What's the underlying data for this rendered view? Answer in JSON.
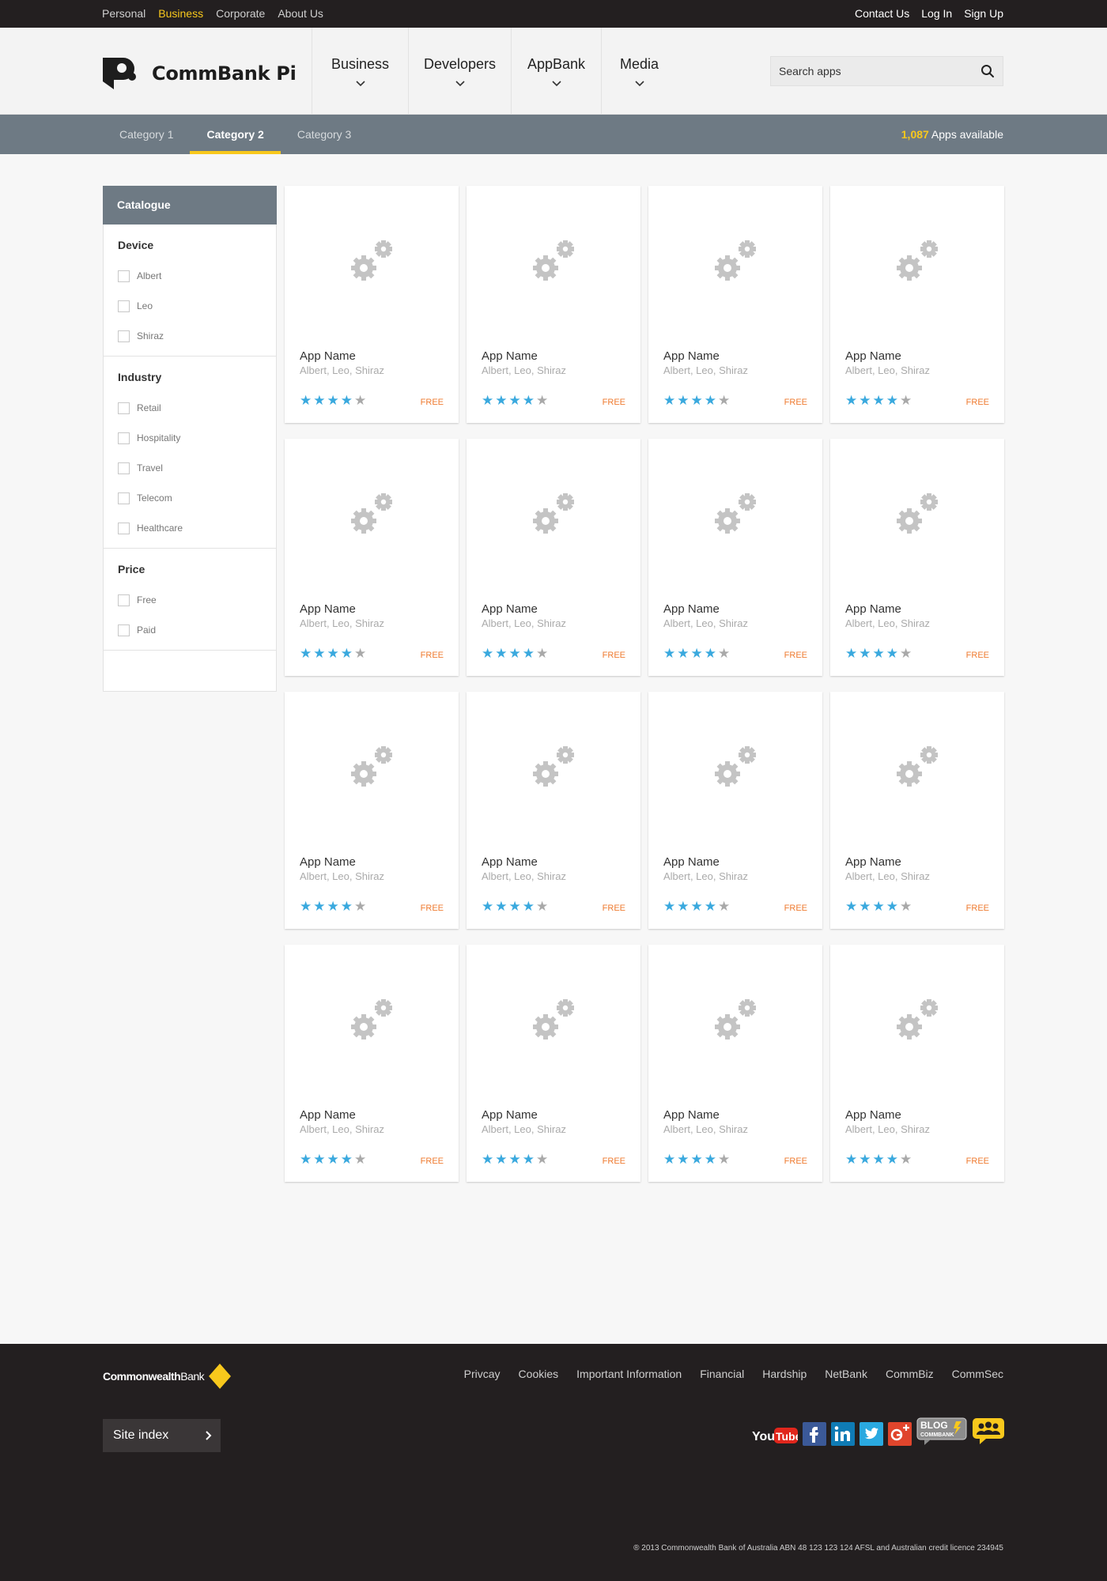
{
  "topbar": {
    "left_links": [
      "Personal",
      "Business",
      "Corporate",
      "About Us"
    ],
    "active_link": "Business",
    "right_links": [
      "Contact Us",
      "Log In",
      "Sign Up"
    ]
  },
  "header": {
    "brand": "CommBank Pi",
    "nav": [
      "Business",
      "Developers",
      "AppBank",
      "Media"
    ],
    "search_placeholder": "Search apps"
  },
  "category_bar": {
    "tabs": [
      "Category 1",
      "Category 2",
      "Category 3"
    ],
    "active_tab": "Category 2",
    "apps_count": "1,087",
    "apps_label": " Apps available"
  },
  "sidebar": {
    "title": "Catalogue",
    "groups": [
      {
        "title": "Device",
        "options": [
          "Albert",
          "Leo",
          "Shiraz"
        ]
      },
      {
        "title": "Industry",
        "options": [
          "Retail",
          "Hospitality",
          "Travel",
          "Telecom",
          "Healthcare"
        ]
      },
      {
        "title": "Price",
        "options": [
          "Free",
          "Paid"
        ]
      }
    ]
  },
  "apps": [
    {
      "name": "App Name",
      "devices": "Albert, Leo, Shiraz",
      "rating": 4,
      "price": "FREE"
    },
    {
      "name": "App Name",
      "devices": "Albert, Leo, Shiraz",
      "rating": 4,
      "price": "FREE"
    },
    {
      "name": "App Name",
      "devices": "Albert, Leo, Shiraz",
      "rating": 4,
      "price": "FREE"
    },
    {
      "name": "App Name",
      "devices": "Albert, Leo, Shiraz",
      "rating": 4,
      "price": "FREE"
    },
    {
      "name": "App Name",
      "devices": "Albert, Leo, Shiraz",
      "rating": 4,
      "price": "FREE"
    },
    {
      "name": "App Name",
      "devices": "Albert, Leo, Shiraz",
      "rating": 4,
      "price": "FREE"
    },
    {
      "name": "App Name",
      "devices": "Albert, Leo, Shiraz",
      "rating": 4,
      "price": "FREE"
    },
    {
      "name": "App Name",
      "devices": "Albert, Leo, Shiraz",
      "rating": 4,
      "price": "FREE"
    },
    {
      "name": "App Name",
      "devices": "Albert, Leo, Shiraz",
      "rating": 4,
      "price": "FREE"
    },
    {
      "name": "App Name",
      "devices": "Albert, Leo, Shiraz",
      "rating": 4,
      "price": "FREE"
    },
    {
      "name": "App Name",
      "devices": "Albert, Leo, Shiraz",
      "rating": 4,
      "price": "FREE"
    },
    {
      "name": "App Name",
      "devices": "Albert, Leo, Shiraz",
      "rating": 4,
      "price": "FREE"
    },
    {
      "name": "App Name",
      "devices": "Albert, Leo, Shiraz",
      "rating": 4,
      "price": "FREE"
    },
    {
      "name": "App Name",
      "devices": "Albert, Leo, Shiraz",
      "rating": 4,
      "price": "FREE"
    },
    {
      "name": "App Name",
      "devices": "Albert, Leo, Shiraz",
      "rating": 4,
      "price": "FREE"
    },
    {
      "name": "App Name",
      "devices": "Albert, Leo, Shiraz",
      "rating": 4,
      "price": "FREE"
    }
  ],
  "rating_max": 5,
  "footer": {
    "brand_bold": "Commonwealth",
    "brand_regular": "Bank",
    "links": [
      "Privcay",
      "Cookies",
      "Important Information",
      "Financial",
      "Hardship",
      "NetBank",
      "CommBiz",
      "CommSec"
    ],
    "site_index": "Site index",
    "social": {
      "youtube_you": "You",
      "youtube_tube": "Tube",
      "blog": "BLOG",
      "blog_sub": "COMMBANK"
    },
    "copyright": "® 2013 Commonwealth Bank of Australia ABN 48 123 123 124 AFSL and Australian credit licence 234945"
  },
  "colors": {
    "accent_yellow": "#f8c81c",
    "star_filled": "#3aa9de",
    "star_empty": "#a9a9a9",
    "price": "#ef7b30",
    "category_bar": "#6e7a84",
    "dark": "#231f20"
  }
}
